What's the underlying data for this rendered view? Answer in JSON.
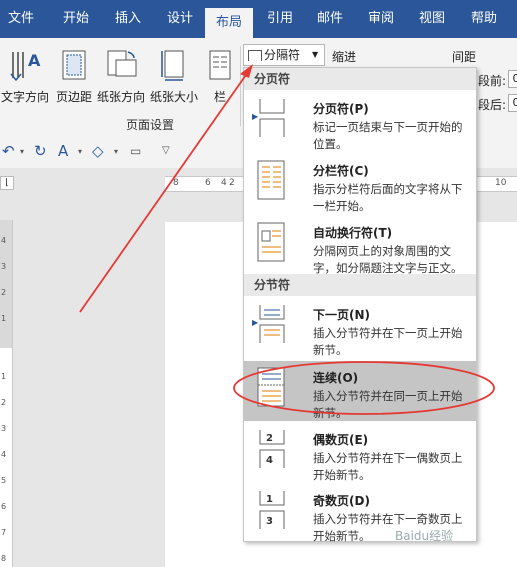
{
  "tabs": [
    "文件",
    "开始",
    "插入",
    "设计",
    "布局",
    "引用",
    "邮件",
    "审阅",
    "视图",
    "帮助"
  ],
  "ribbon": {
    "buttons": [
      {
        "label": "文字方向"
      },
      {
        "label": "页边距"
      },
      {
        "label": "纸张方向"
      },
      {
        "label": "纸张大小"
      },
      {
        "label": "栏"
      }
    ],
    "group_label": "页面设置",
    "breaks_button": "分隔符",
    "indent_label": "缩进",
    "spacing_label": "间距",
    "before_label": "段前:",
    "after_label": "段后:",
    "before_value": "0",
    "after_value": "0"
  },
  "ruler": {
    "horizontal": [
      "8",
      "6",
      "4",
      "2",
      "10"
    ],
    "vertical": [
      "4",
      "3",
      "2",
      "1",
      "1",
      "1",
      "2",
      "3",
      "4",
      "5",
      "6",
      "7",
      "8"
    ]
  },
  "dropdown": {
    "section_page_breaks": "分页符",
    "section_section_breaks": "分节符",
    "items": [
      {
        "title": "分页符(P)",
        "desc": "标记一页结束与下一页开始的位置。"
      },
      {
        "title": "分栏符(C)",
        "desc": "指示分栏符后面的文字将从下一栏开始。"
      },
      {
        "title": "自动换行符(T)",
        "desc": "分隔网页上的对象周围的文字，如分隔题注文字与正文。"
      },
      {
        "title": "下一页(N)",
        "desc": "插入分节符并在下一页上开始新节。"
      },
      {
        "title": "连续(O)",
        "desc": "插入分节符并在同一页上开始新节。"
      },
      {
        "title": "偶数页(E)",
        "desc": "插入分节符并在下一偶数页上开始新节。"
      },
      {
        "title": "奇数页(D)",
        "desc": "插入分节符并在下一奇数页上开始新节。"
      }
    ]
  },
  "watermark": "Baidu经验",
  "colors": {
    "accent": "#2b579a",
    "annotation": "#e53935",
    "highlight": "#c5c5c5"
  }
}
